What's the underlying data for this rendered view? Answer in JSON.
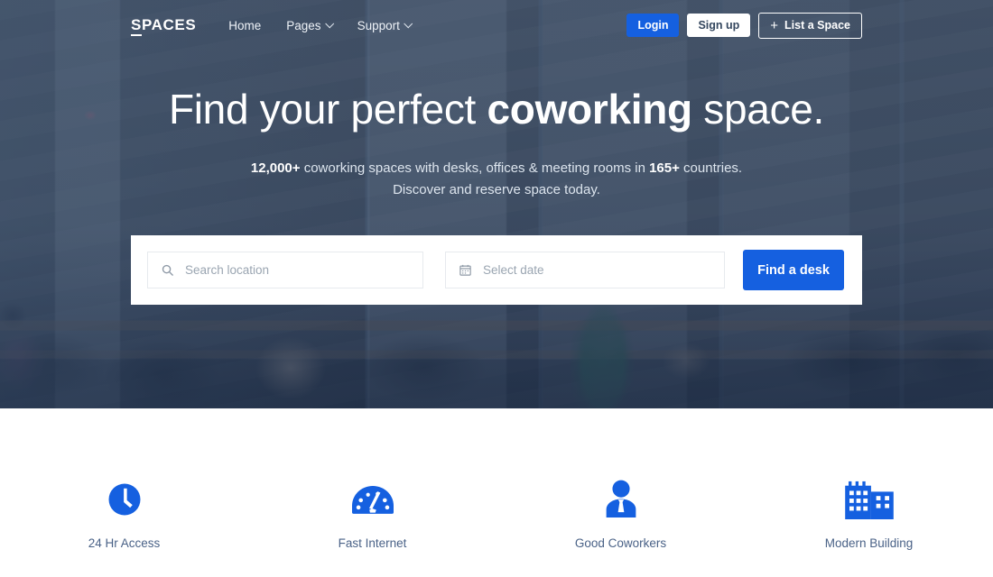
{
  "navbar": {
    "brand_first": "S",
    "brand_rest": "PACES",
    "links": [
      {
        "label": "Home",
        "has_caret": false
      },
      {
        "label": "Pages",
        "has_caret": true
      },
      {
        "label": "Support",
        "has_caret": true
      }
    ],
    "login_label": "Login",
    "signup_label": "Sign up",
    "list_space_label": "List a Space",
    "list_space_plus": "+"
  },
  "hero": {
    "title_part1": "Find your perfect ",
    "title_bold": "coworking",
    "title_part2": " space.",
    "sub_line1_strong1": "12,000+",
    "sub_line1_mid": " coworking spaces with desks, offices & meeting rooms in ",
    "sub_line1_strong2": "165+",
    "sub_line1_end": " countries.",
    "sub_line2": "Discover and reserve space today."
  },
  "search": {
    "location_placeholder": "Search location",
    "location_value": "",
    "date_placeholder": "Select date",
    "date_value": "",
    "submit_label": "Find a desk",
    "search_icon": "search-icon",
    "calendar_icon": "calendar-icon"
  },
  "features": [
    {
      "icon": "clock-icon",
      "label": "24 Hr Access"
    },
    {
      "icon": "speedometer-icon",
      "label": "Fast Internet"
    },
    {
      "icon": "person-tie-icon",
      "label": "Good Coworkers"
    },
    {
      "icon": "building-icon",
      "label": "Modern Building"
    }
  ],
  "colors": {
    "accent_blue": "#1560e0",
    "overlay_navy": "#2a3e5c",
    "feature_label": "#4a6287",
    "card_white": "#ffffff"
  }
}
